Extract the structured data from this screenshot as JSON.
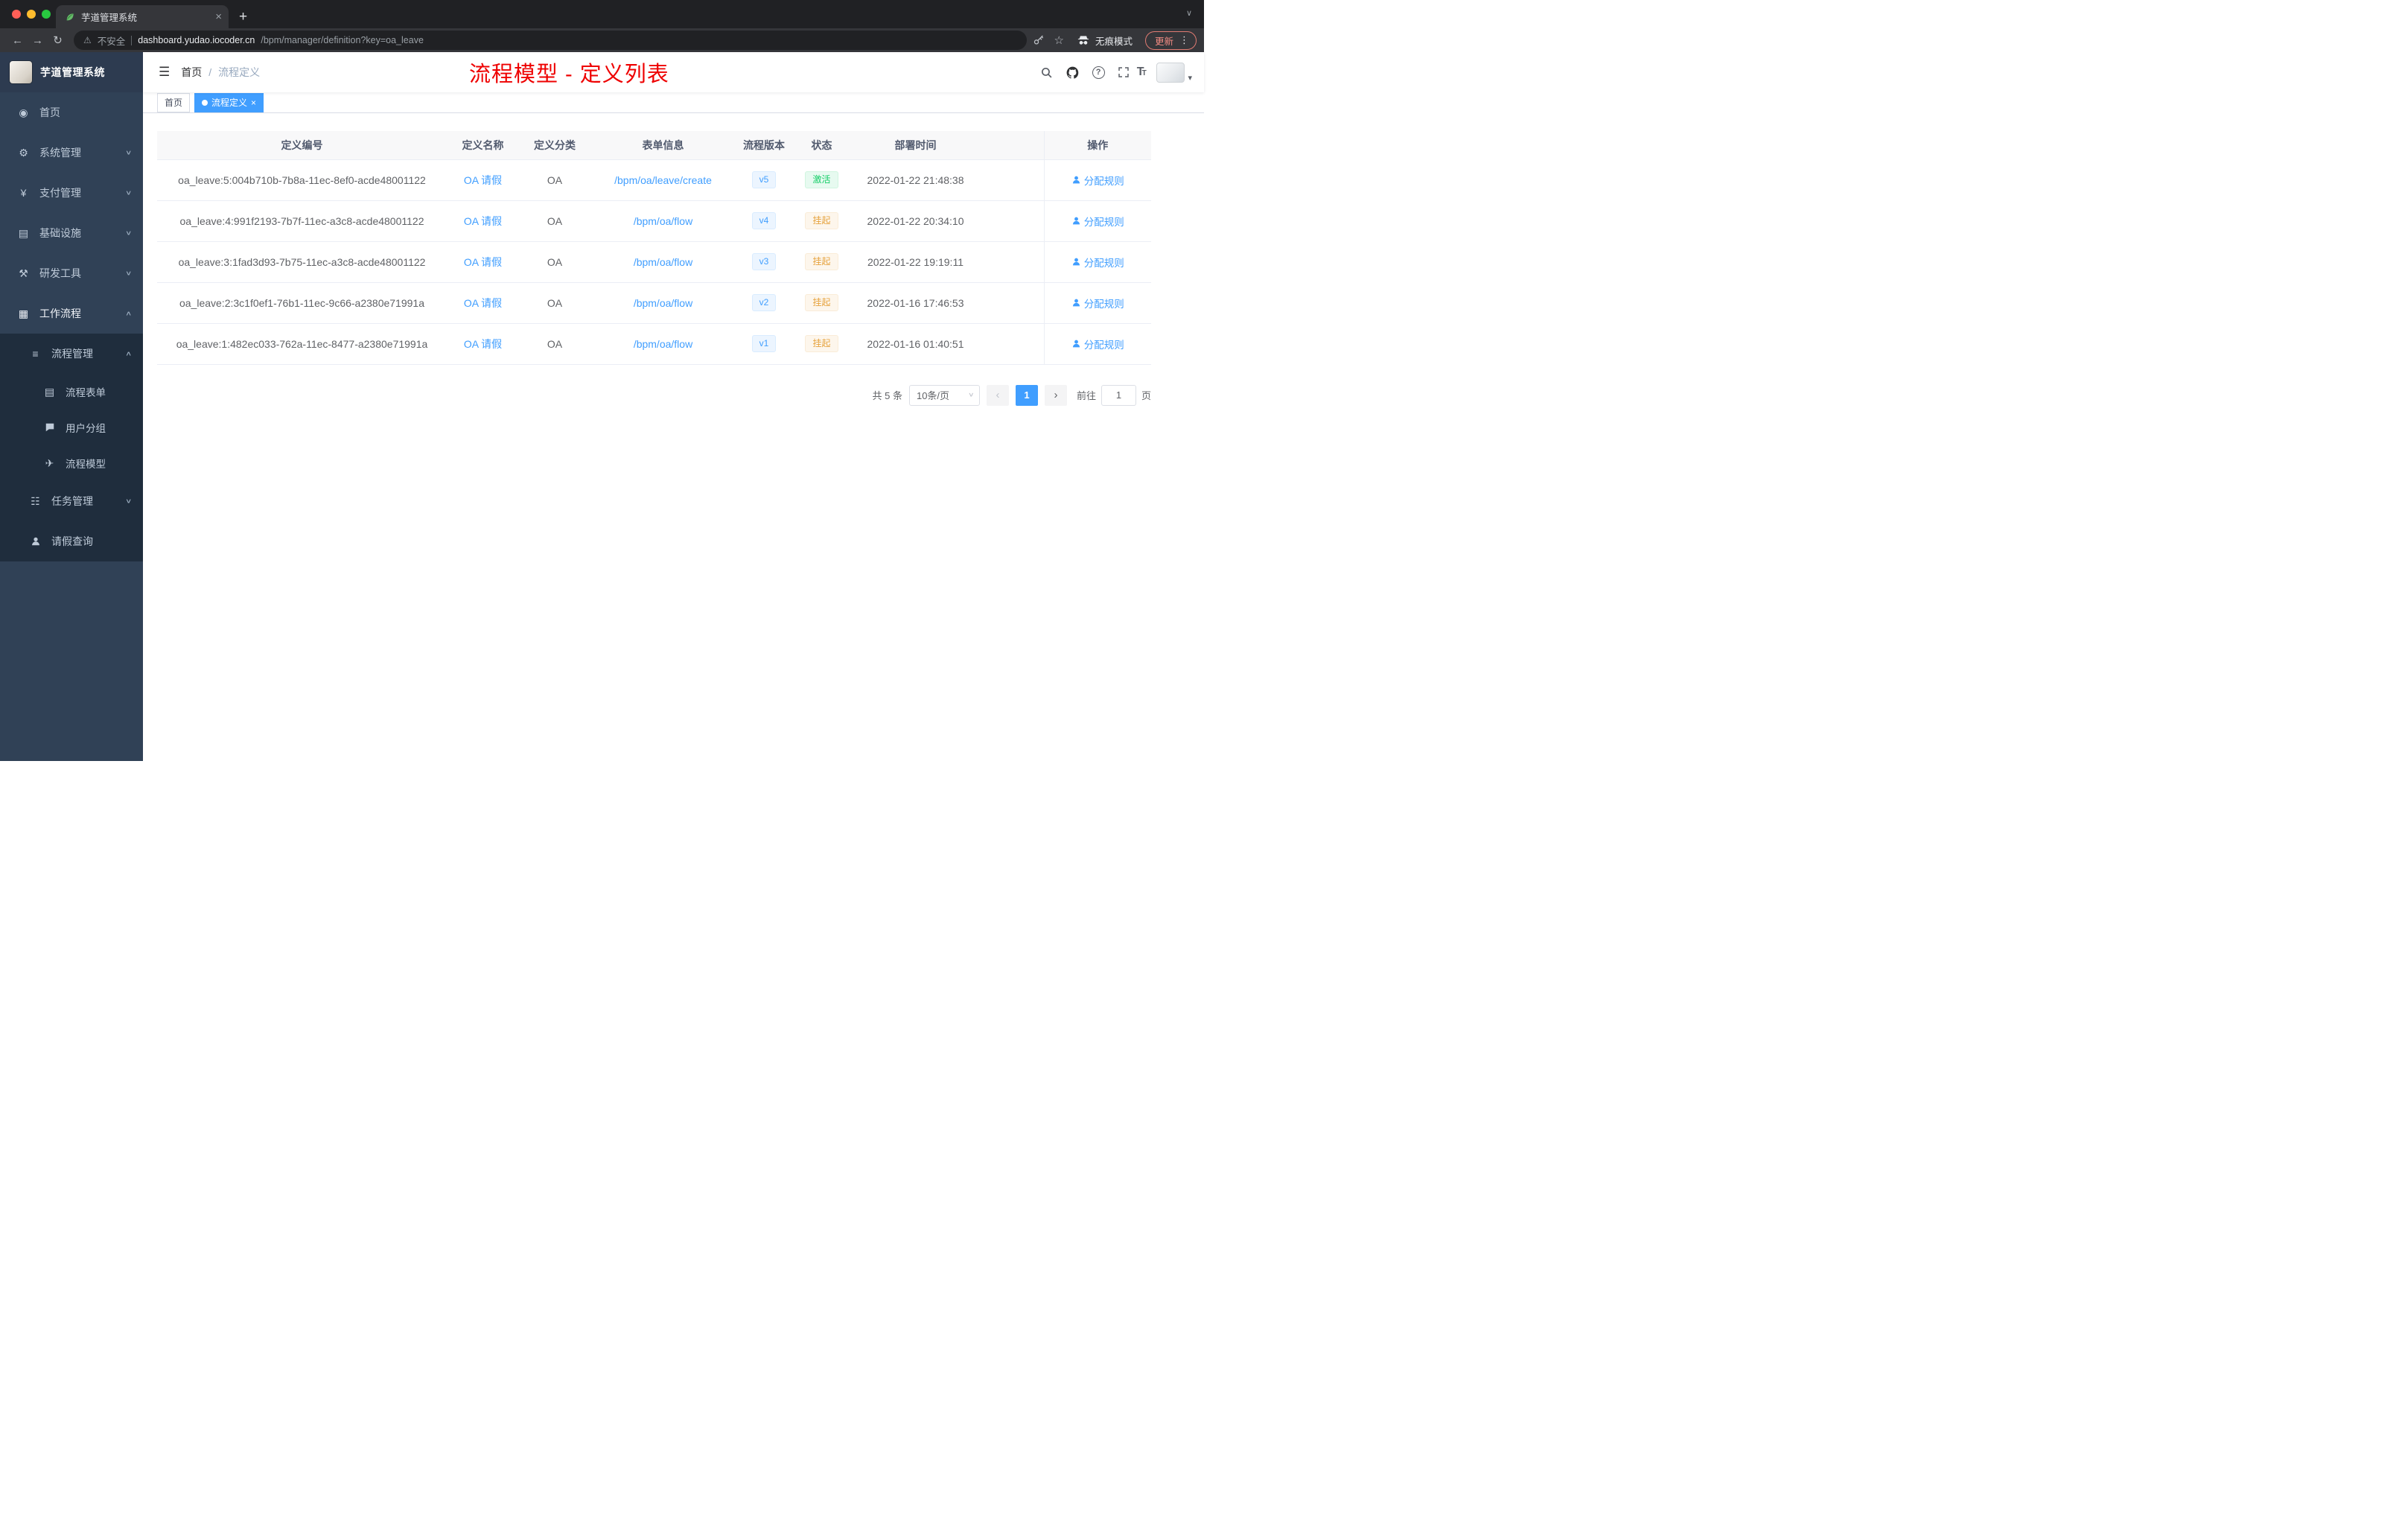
{
  "colors": {
    "accent": "#409eff",
    "success_text": "#13ce66",
    "warning_text": "#e6a23c",
    "sidebar_bg": "#304156",
    "submenu_bg": "#1f2d3d",
    "annotation_red": "#ee0000",
    "active_tag_bg": "#409eff"
  },
  "browser": {
    "tab_title": "芋道管理系统",
    "not_secure": "不安全",
    "url_host": "dashboard.yudao.iocoder.cn",
    "url_path": "/bpm/manager/definition?key=oa_leave",
    "incognito": "无痕模式",
    "update": "更新"
  },
  "icons": {
    "back": "←",
    "forward": "→",
    "reload": "↻",
    "warning": "⚠",
    "star": "☆",
    "dots": "⋮",
    "plus": "+",
    "close": "×",
    "chevron_down": "∨",
    "chevron_up": "∧",
    "caret_down": "▾",
    "hamburger": "☰",
    "help": "?",
    "font_size": "T",
    "prev": "‹",
    "next": "›"
  },
  "sidebar": {
    "title": "芋道管理系统",
    "items": [
      {
        "icon": "◉",
        "label": "首页"
      },
      {
        "icon": "⚙",
        "label": "系统管理",
        "chevron": "∨"
      },
      {
        "icon": "¥",
        "label": "支付管理",
        "chevron": "∨"
      },
      {
        "icon": "▤",
        "label": "基础设施",
        "chevron": "∨"
      },
      {
        "icon": "⚒",
        "label": "研发工具",
        "chevron": "∨"
      },
      {
        "icon": "▦",
        "label": "工作流程",
        "chevron": "∧"
      },
      {
        "icon": "≡",
        "label": "流程管理",
        "chevron": "∧"
      },
      {
        "icon": "▤",
        "label": "流程表单"
      },
      {
        "icon": "",
        "label": "用户分组"
      },
      {
        "icon": "✈",
        "label": "流程模型"
      },
      {
        "icon": "☷",
        "label": "任务管理",
        "chevron": "∨"
      },
      {
        "icon": "",
        "label": "请假查询"
      }
    ]
  },
  "header": {
    "breadcrumb_home": "首页",
    "breadcrumb_sep": "/",
    "breadcrumb_current": "流程定义",
    "annotation": "流程模型 - 定义列表"
  },
  "tags": [
    {
      "label": "首页"
    },
    {
      "label": "流程定义"
    }
  ],
  "table": {
    "columns": [
      "定义编号",
      "定义名称",
      "定义分类",
      "表单信息",
      "流程版本",
      "状态",
      "部署时间",
      "操作"
    ],
    "rows": [
      {
        "id": "oa_leave:5:004b710b-7b8a-11ec-8ef0-acde48001122",
        "name": "OA 请假",
        "category": "OA",
        "form": "/bpm/oa/leave/create",
        "version": "v5",
        "status": "激活",
        "time": "2022-01-22 21:48:38",
        "action": "分配规则"
      },
      {
        "id": "oa_leave:4:991f2193-7b7f-11ec-a3c8-acde48001122",
        "name": "OA 请假",
        "category": "OA",
        "form": "/bpm/oa/flow",
        "version": "v4",
        "status": "挂起",
        "time": "2022-01-22 20:34:10",
        "action": "分配规则"
      },
      {
        "id": "oa_leave:3:1fad3d93-7b75-11ec-a3c8-acde48001122",
        "name": "OA 请假",
        "category": "OA",
        "form": "/bpm/oa/flow",
        "version": "v3",
        "status": "挂起",
        "time": "2022-01-22 19:19:11",
        "action": "分配规则"
      },
      {
        "id": "oa_leave:2:3c1f0ef1-76b1-11ec-9c66-a2380e71991a",
        "name": "OA 请假",
        "category": "OA",
        "form": "/bpm/oa/flow",
        "version": "v2",
        "status": "挂起",
        "time": "2022-01-16 17:46:53",
        "action": "分配规则"
      },
      {
        "id": "oa_leave:1:482ec033-762a-11ec-8477-a2380e71991a",
        "name": "OA 请假",
        "category": "OA",
        "form": "/bpm/oa/flow",
        "version": "v1",
        "status": "挂起",
        "time": "2022-01-16 01:40:51",
        "action": "分配规则"
      }
    ]
  },
  "pagination": {
    "total": "共 5 条",
    "page_size": "10条/页",
    "page": "1",
    "goto_label": "前往",
    "goto_value": "1",
    "unit": "页"
  }
}
